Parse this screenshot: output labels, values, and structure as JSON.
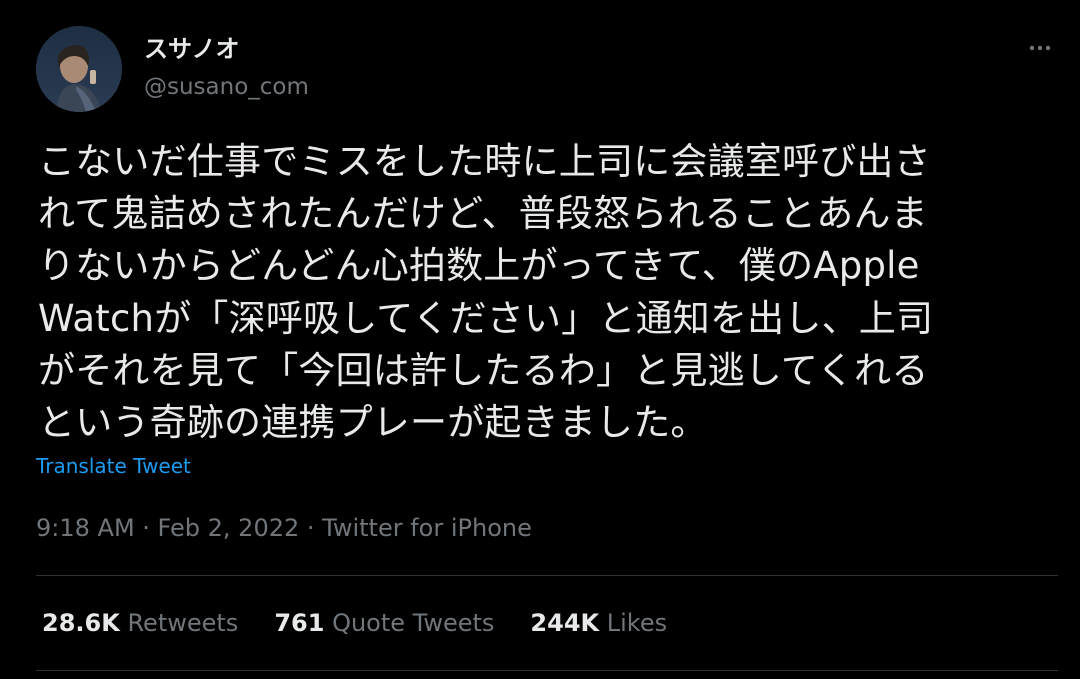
{
  "user": {
    "display_name": "スサノオ",
    "handle": "@susano_com"
  },
  "tweet": {
    "lines": [
      "こないだ仕事でミスをした時に上司に会議室呼び出さ",
      "れて鬼詰めされたんだけど、普段怒られることあんま",
      "りないからどんどん心拍数上がってきて、僕のApple",
      "Watchが「深呼吸してください」と通知を出し、上司",
      "がそれを見て「今回は許したるわ」と見逃してくれる",
      "という奇跡の連携プレーが起きました。"
    ],
    "translate_label": "Translate Tweet",
    "meta": "9:18 AM · Feb 2, 2022 · Twitter for iPhone"
  },
  "stats": {
    "retweets_count": "28.6K",
    "retweets_label": "Retweets",
    "quotes_count": "761",
    "quotes_label": "Quote Tweets",
    "likes_count": "244K",
    "likes_label": "Likes"
  },
  "icons": {
    "more": "more-horizontal-icon"
  },
  "colors": {
    "background": "#000000",
    "text": "#e7e9ea",
    "secondary": "#71767b",
    "link": "#1d9bf0",
    "divider": "#2f3336"
  }
}
